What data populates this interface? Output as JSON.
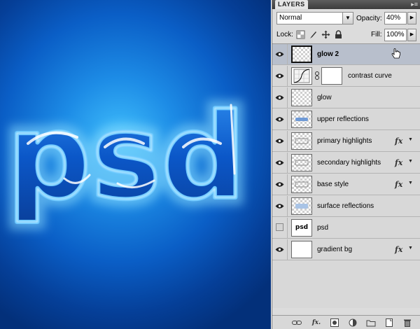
{
  "canvas": {
    "artwork_text": "psd",
    "colors": {
      "glow": "#7fd6ff",
      "letter_fill": "#0a4fc0",
      "letter_edge": "#bff0ff"
    }
  },
  "panel": {
    "tab_label": "LAYERS",
    "menu_icon": "panel-menu-icon",
    "blend_mode": "Normal",
    "opacity_label": "Opacity:",
    "opacity_value": "40%",
    "lock_label": "Lock:",
    "lock_icons": [
      "lock-transparency-icon",
      "lock-image-icon",
      "lock-position-icon",
      "lock-all-icon"
    ],
    "fill_label": "Fill:",
    "fill_value": "100%",
    "footer_icons": [
      "link-layers-icon",
      "fx-icon",
      "add-mask-icon",
      "adjustment-layer-icon",
      "new-group-icon",
      "new-layer-icon",
      "trash-icon"
    ]
  },
  "layers": [
    {
      "name": "glow 2",
      "visible": true,
      "selected": true,
      "fx": false,
      "thumb": "transparent"
    },
    {
      "name": "contrast curve",
      "visible": true,
      "selected": false,
      "fx": false,
      "thumb": "curves-adjustment"
    },
    {
      "name": "glow",
      "visible": true,
      "selected": false,
      "fx": false,
      "thumb": "transparent"
    },
    {
      "name": "upper reflections",
      "visible": true,
      "selected": false,
      "fx": false,
      "thumb": "transparent-psd"
    },
    {
      "name": "primary highlights",
      "visible": true,
      "selected": false,
      "fx": true,
      "thumb": "transparent-psd"
    },
    {
      "name": "secondary highlights",
      "visible": true,
      "selected": false,
      "fx": true,
      "thumb": "transparent-psd"
    },
    {
      "name": "base style",
      "visible": true,
      "selected": false,
      "fx": true,
      "thumb": "transparent-psd"
    },
    {
      "name": "surface reflections",
      "visible": true,
      "selected": false,
      "fx": false,
      "thumb": "transparent-psd"
    },
    {
      "name": "psd",
      "visible": false,
      "selected": false,
      "fx": false,
      "thumb": "white-psd",
      "thumb_text": "psd"
    },
    {
      "name": "gradient bg",
      "visible": true,
      "selected": false,
      "fx": true,
      "thumb": "white"
    }
  ]
}
